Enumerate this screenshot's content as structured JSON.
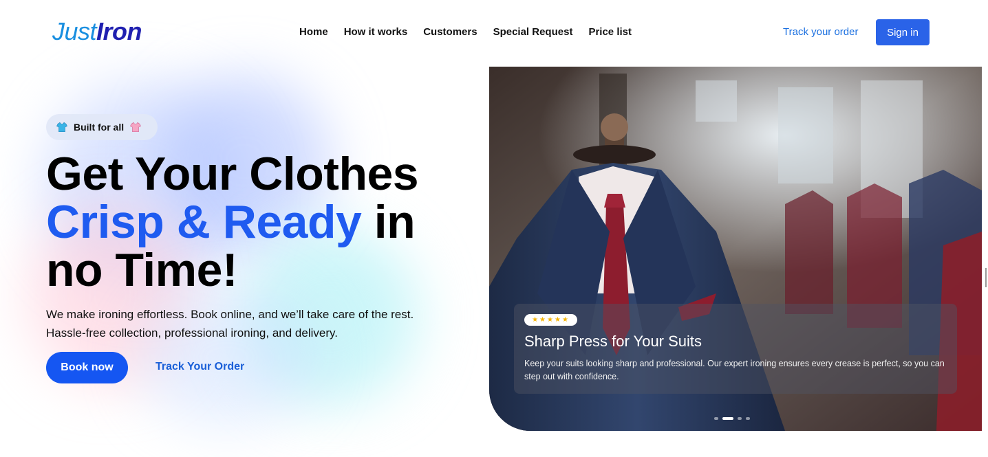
{
  "brand": {
    "logo_part1": "Just",
    "logo_part2": "Iron"
  },
  "nav": {
    "items": [
      {
        "label": "Home"
      },
      {
        "label": "How it works"
      },
      {
        "label": "Customers"
      },
      {
        "label": "Special Request"
      },
      {
        "label": "Price list"
      }
    ],
    "track_order_label": "Track your order",
    "sign_in_label": "Sign in"
  },
  "hero": {
    "badge_label": "Built for all",
    "badge_icons": [
      "shirt-icon-blue",
      "shirt-icon-pink"
    ],
    "title_line1": "Get Your Clothes",
    "title_accent": "Crisp & Ready",
    "title_line2_rest": " in",
    "title_line3": "no Time!",
    "subtitle_line1": "We make ironing effortless. Book online, and we’ll take care of the rest.",
    "subtitle_line2": "Hassle-free collection, professional ironing, and delivery.",
    "book_button": "Book now",
    "track_button": "Track Your Order"
  },
  "slide": {
    "rating_stars": "★★★★★",
    "title": "Sharp Press for Your Suits",
    "text": "Keep your suits looking sharp and professional. Our expert ironing ensures every crease is perfect, so you can step out with confidence.",
    "total_slides": 4,
    "active_slide": 2
  },
  "colors": {
    "accent": "#1f5bf0",
    "button": "#1556f2",
    "signin": "#2a63e8",
    "link": "#1a6fe0"
  }
}
